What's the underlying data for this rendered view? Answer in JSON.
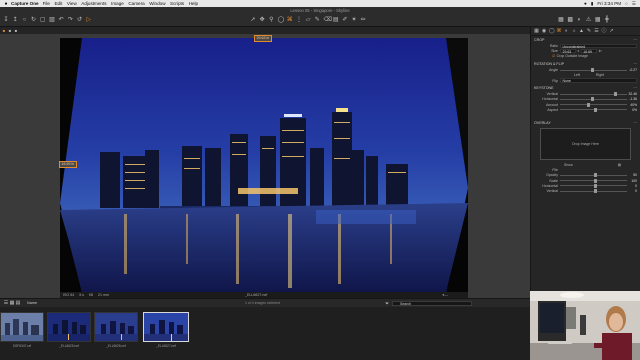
{
  "menubar": {
    "app_name": "Capture One",
    "items": [
      "File",
      "Edit",
      "View",
      "Adjustments",
      "Image",
      "Camera",
      "Window",
      "Scripts",
      "Help"
    ],
    "clock": "Fri 3:34 PM"
  },
  "window": {
    "title": "Lesson 05 - Singapore - Skyline"
  },
  "viewer": {
    "crop_width_tag": "29.63 in",
    "crop_height_tag": "16.69 in",
    "status": {
      "iso": "ISO 64",
      "shutter": "5 s",
      "aperture": "f/8",
      "focal": "21 mm",
      "filename": "_ELL6627.nef"
    },
    "count": "1 of 4 images selected"
  },
  "right_panel": {
    "crop": {
      "header": "Crop",
      "ratio_label": "Ratio",
      "ratio_value": "Unconstrained",
      "size_label": "Size",
      "size_w": "29.63",
      "size_x": "x",
      "size_h": "16.69",
      "size_unit": "in",
      "outside_label": "Crop Outside Image"
    },
    "rotation": {
      "header": "Rotation & Flip",
      "angle_label": "Angle",
      "angle_value": "-0.27",
      "left": "Left",
      "right": "Right",
      "flip_label": "Flip",
      "flip_value": "None"
    },
    "keystone": {
      "header": "Keystone",
      "vertical_label": "Vertical",
      "vertical_value": "32.46",
      "horizontal_label": "Horizontal",
      "horizontal_value": "-1.36",
      "amount_label": "Amount",
      "amount_value": "40%",
      "aspect_label": "Aspect",
      "aspect_value": "0%"
    },
    "overlay": {
      "header": "Overlay",
      "drop_text": "Drop Image Here",
      "show_label": "Show",
      "file_label": "File",
      "opacity_label": "Opacity",
      "opacity_value": "50",
      "scale_label": "Scale",
      "scale_value": "100",
      "horizontal_label": "Horizontal",
      "horizontal_value": "0",
      "vertical_label": "Vertical",
      "vertical_value": "0"
    }
  },
  "browser": {
    "sort_label": "Name",
    "search_placeholder": "Search",
    "thumbnails": [
      {
        "name": "DSF6347.raf",
        "selected": false
      },
      {
        "name": "_ELL6625.nef",
        "selected": false
      },
      {
        "name": "_ELL6626.nef",
        "selected": false
      },
      {
        "name": "_ELL6627.nef",
        "selected": true
      }
    ]
  },
  "colors": {
    "accent": "#e48a2a",
    "panel": "#262626",
    "viewer_bg": "#3a3a3a"
  }
}
